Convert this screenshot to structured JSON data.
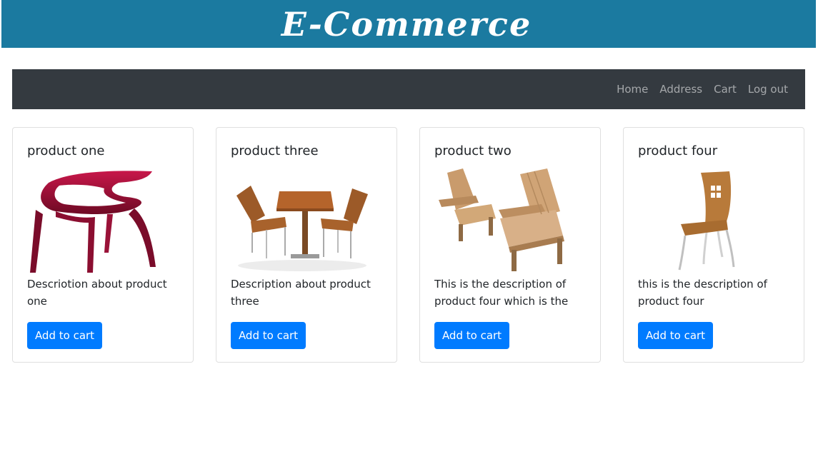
{
  "header": {
    "title": "E-Commerce"
  },
  "nav": {
    "items": [
      {
        "label": "Home"
      },
      {
        "label": "Address"
      },
      {
        "label": "Cart"
      },
      {
        "label": "Log out"
      }
    ]
  },
  "products": [
    {
      "title": "product one",
      "description": "Descriotion about product one",
      "button_label": "Add to cart",
      "image": "red-chair-image"
    },
    {
      "title": "product three",
      "description": "Description about product three",
      "button_label": "Add to cart",
      "image": "patio-table-set-image"
    },
    {
      "title": "product two",
      "description": "This is the description of product four which is the",
      "button_label": "Add to cart",
      "image": "adirondack-chairs-image"
    },
    {
      "title": "product four",
      "description": "this is the description of product four",
      "button_label": "Add to cart",
      "image": "wooden-chair-image"
    }
  ],
  "colors": {
    "banner": "#1b7aa0",
    "navbar": "#343a40",
    "button": "#007bff"
  }
}
